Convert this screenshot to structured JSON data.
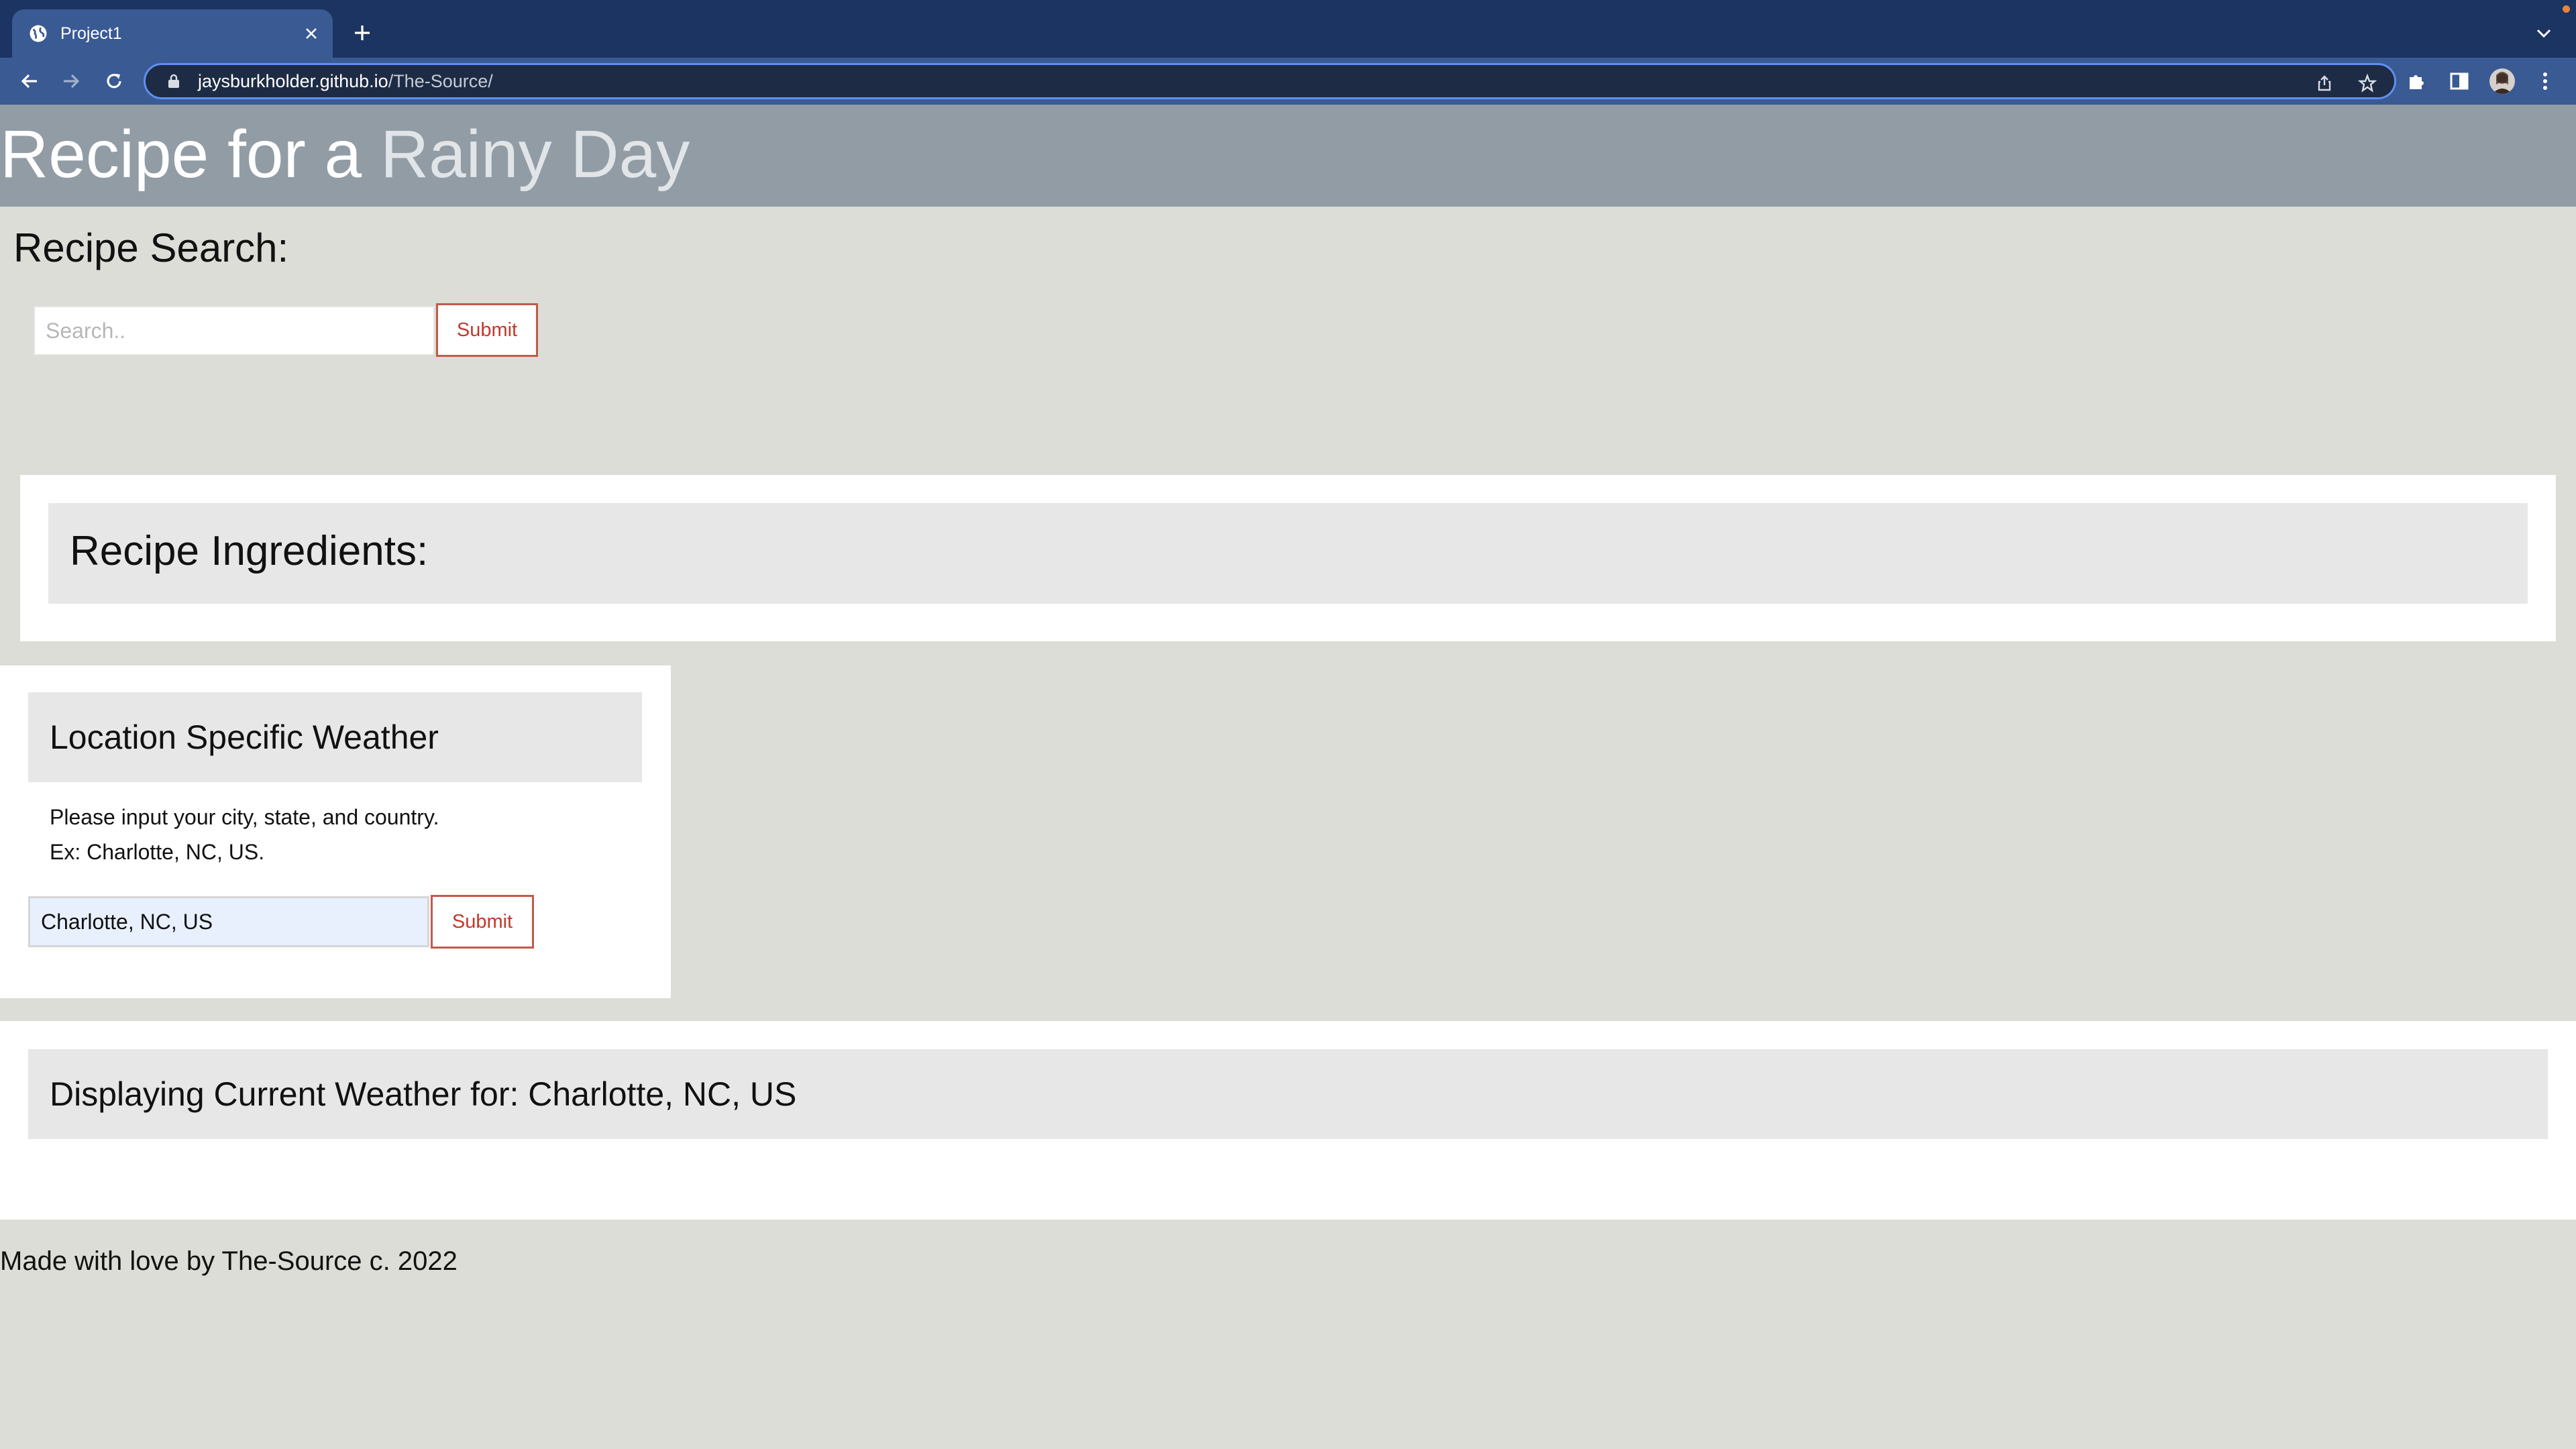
{
  "browser": {
    "tab_title": "Project1",
    "url_host": "jaysburkholder.github.io",
    "url_path": "/The-Source/"
  },
  "header": {
    "title_main": "Recipe for a ",
    "title_accent": "Rainy Day"
  },
  "recipe_search": {
    "heading": "Recipe Search:",
    "placeholder": "Search..",
    "submit_label": "Submit"
  },
  "ingredients": {
    "heading": "Recipe Ingredients:"
  },
  "weather": {
    "heading": "Location Specific Weather",
    "instruction_line1": "Please input your city, state, and country.",
    "instruction_line2": "Ex: Charlotte, NC, US.",
    "input_value": "Charlotte, NC, US",
    "submit_label": "Submit"
  },
  "current_weather": {
    "heading": "Displaying Current Weather for: Charlotte, NC, US"
  },
  "footer": {
    "text": "Made with love by The-Source c. 2022"
  },
  "colors": {
    "tabbar": "#1b3461",
    "toolbar": "#3a5a94",
    "page_background": "#dbddd6",
    "header_background": "#929ca5",
    "button_accent": "#c0392b"
  }
}
